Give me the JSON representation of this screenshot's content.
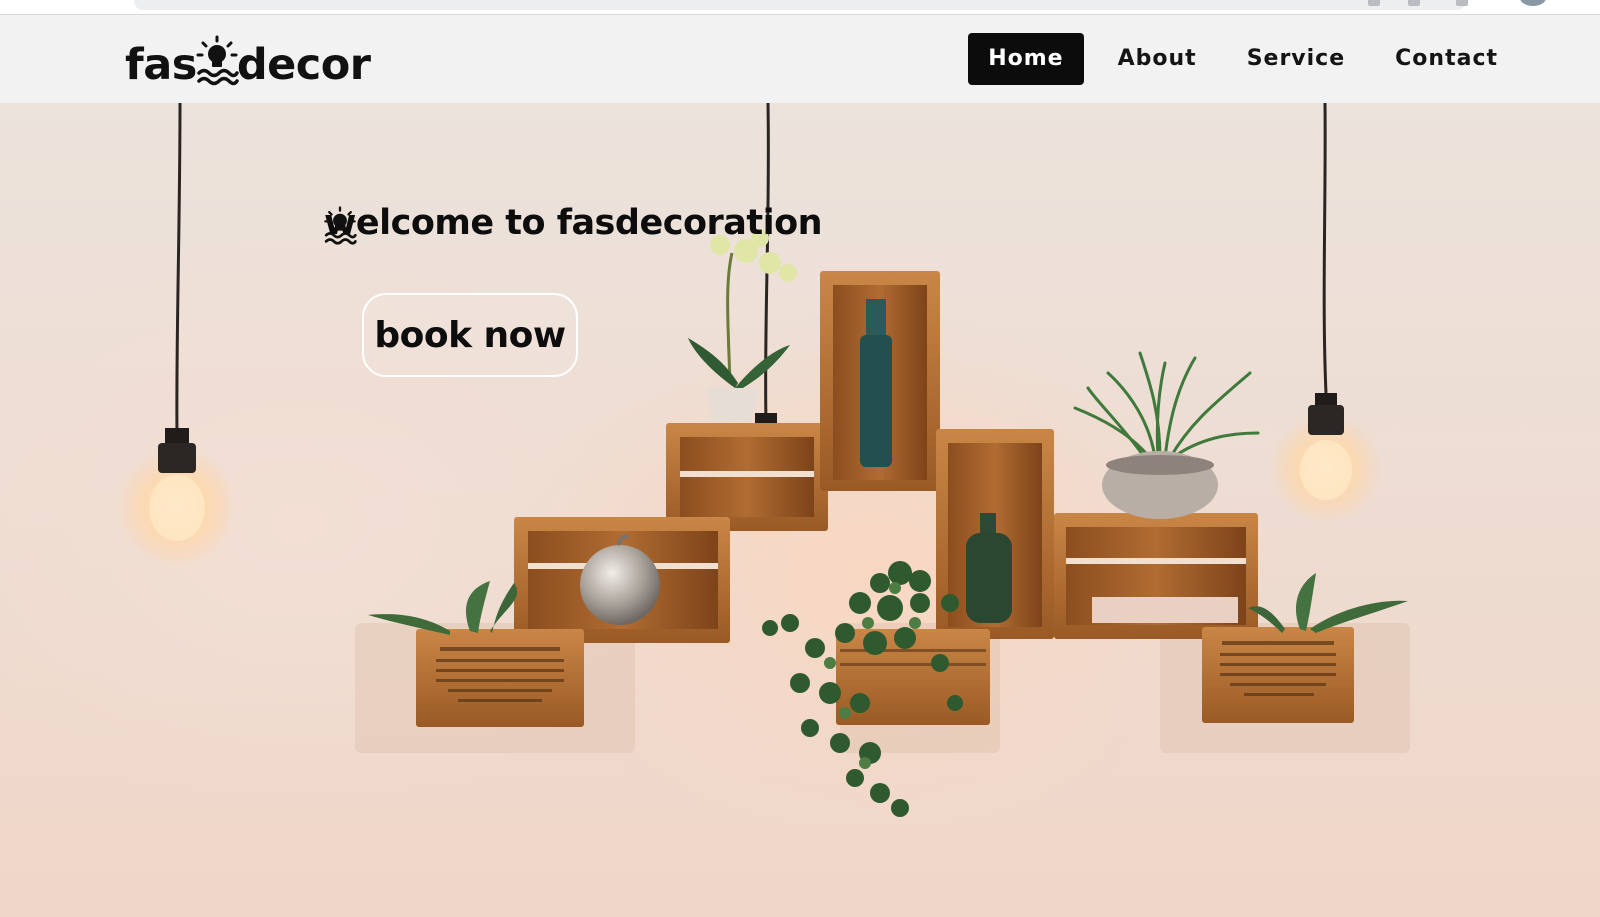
{
  "brand": {
    "prefix": "fas",
    "suffix": "decor",
    "logo_icon": "lightbulb-wave-icon"
  },
  "nav": {
    "items": [
      {
        "label": "Home",
        "active": true
      },
      {
        "label": "About",
        "active": false
      },
      {
        "label": "Service",
        "active": false
      },
      {
        "label": "Contact",
        "active": false
      }
    ]
  },
  "hero": {
    "welcome_prefix": "welcome to fas",
    "welcome_suffix": "decoration",
    "cta_label": "book now"
  },
  "colors": {
    "nav_background": "#f2f2f2",
    "active_nav_background": "#0c0c0c",
    "text": "#0d0d0d",
    "wall": "#efe0d6",
    "wood": "#b5702e"
  }
}
